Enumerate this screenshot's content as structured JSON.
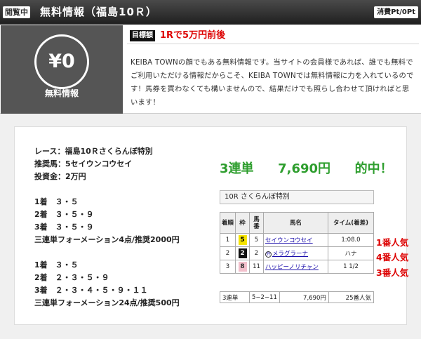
{
  "header": {
    "badge": "閲覧中",
    "title": "無料情報（福島10Ｒ）",
    "points": "消費Pt/0Pt"
  },
  "info": {
    "price": "¥0",
    "price_label": "無料情報",
    "target_badge": "目標額",
    "target_text": "1Rで5万円前後",
    "description": "KEIBA TOWNの顔でもある無料情報です。当サイトの会員様であれば、誰でも無料でご利用いただける情報だからこそ、KEIBA TOWNでは無料情報に力を入れているのです！馬券を買わなくても構いませんので、結果だけでも照らし合わせて頂ければと思います！"
  },
  "race_info": {
    "race": "レース：福島10Ｒさくらんぼ特別",
    "horse": "推奨馬：5セイウンコウセイ",
    "amount": "投資金：2万円",
    "set1": {
      "first": "1着　３・５",
      "second": "2着　３・５・９",
      "third": "3着　３・５・９",
      "summary": "三連単フォーメーション4点/推奨2000円"
    },
    "set2": {
      "first": "1着　３・５",
      "second": "2着　２・３・５・９",
      "third": "3着　２・３・４・５・９・１１",
      "summary": "三連単フォーメーション24点/推奨500円"
    }
  },
  "hit": {
    "type": "3連単",
    "amount": "7,690円",
    "result": "的中！"
  },
  "result_table": {
    "title": "10R さくらんぼ特別",
    "headers": {
      "rank": "着順",
      "waku": "枠",
      "num": "馬番",
      "name": "馬名",
      "time": "タイム(着差)"
    },
    "rows": [
      {
        "rank": "1",
        "waku": "5",
        "waku_bg": "#f5e400",
        "waku_fg": "#000",
        "num": "5",
        "mark": "",
        "name": "セイウンコウセイ",
        "time": "1:08.0",
        "pop": "1番人気"
      },
      {
        "rank": "2",
        "waku": "2",
        "waku_bg": "#111111",
        "waku_fg": "#fff",
        "num": "2",
        "mark": "外",
        "name": "メラグラーナ",
        "time": "ハナ",
        "pop": "4番人気"
      },
      {
        "rank": "3",
        "waku": "8",
        "waku_bg": "#f3c0cc",
        "waku_fg": "#333",
        "num": "11",
        "mark": "",
        "name": "ハッピーノリチャン",
        "time": "1 1/2",
        "pop": "3番人気"
      }
    ],
    "payout": {
      "type": "3連単",
      "combo": "5−2−11",
      "amount": "7,690円",
      "popularity": "25番人気"
    }
  },
  "colors": {
    "hit_green": "#2e9e2e",
    "popularity_red": "#dd0000",
    "header_dark": "#2a2a2a"
  }
}
